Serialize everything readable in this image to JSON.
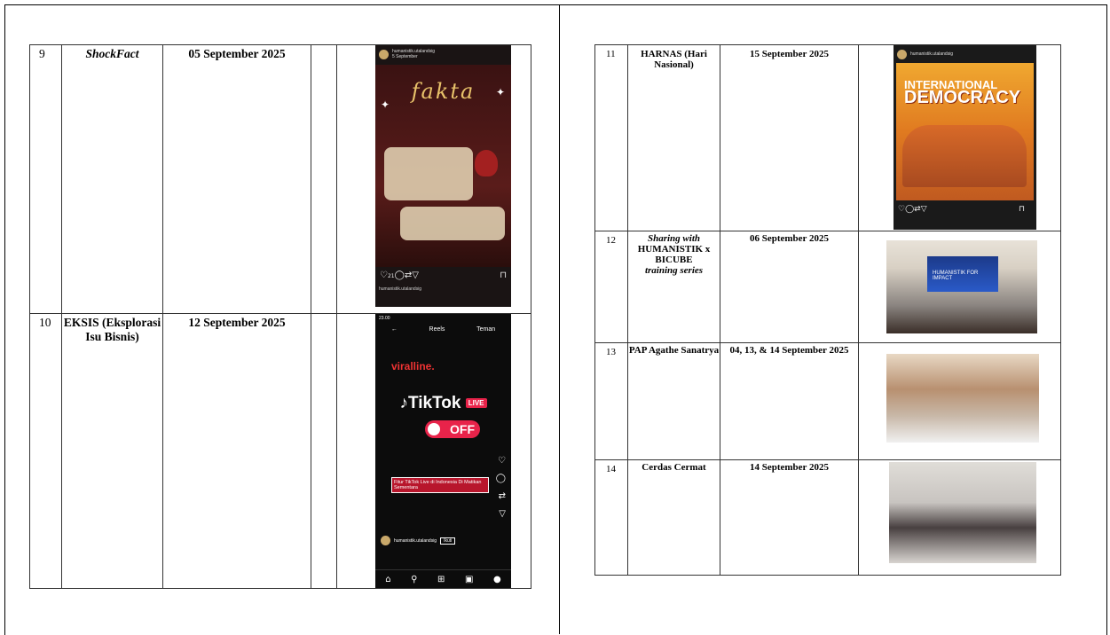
{
  "left_rows": [
    {
      "num": "9",
      "name": "ShockFact",
      "date": "05 September 2025",
      "image": {
        "account": "humanistik.utalandsig",
        "posted": "5 September",
        "title": "fakta",
        "likes": "21"
      }
    },
    {
      "num": "10",
      "name": "EKSIS (Eksplorasi Isu Bisnis)",
      "date": "12 September 2025",
      "image": {
        "time": "23.00",
        "tabs": [
          "Reels",
          "Teman"
        ],
        "brand": "viralline.",
        "app": "TikTok",
        "live_badge": "LIVE",
        "status": "OFF",
        "notice": "Fitur TikTok Live di Indonesia Di Matikan Sementara",
        "account": "humanistik.utalandsig",
        "follow": "Ikuti"
      }
    }
  ],
  "right_rows": [
    {
      "num": "11",
      "name": "HARNAS (Hari Nasional)",
      "date": "15 September 2025",
      "image": {
        "account": "humanistik.utalandsig",
        "poster_line1": "INTERNATIONAL",
        "poster_line2": "DEMOCRACY"
      }
    },
    {
      "num": "12",
      "name_parts": [
        "Sharing with",
        "HUMANISTIK x BICUBE",
        "training series"
      ],
      "date": "06 September 2025",
      "image": {
        "screen_text": "HUMANISTIK FOR IMPACT"
      }
    },
    {
      "num": "13",
      "name": "PAP Agathe Sanatrya",
      "date": "04, 13, & 14 September 2025",
      "image": {}
    },
    {
      "num": "14",
      "name": "Cerdas Cermat",
      "date": "14 September 2025",
      "image": {}
    }
  ],
  "icons": {
    "ig_actions": [
      "heart-icon",
      "comment-icon",
      "repost-icon",
      "share-icon",
      "bookmark-icon"
    ],
    "nav": [
      "home-icon",
      "search-icon",
      "add-icon",
      "reels-icon",
      "profile-icon"
    ]
  }
}
